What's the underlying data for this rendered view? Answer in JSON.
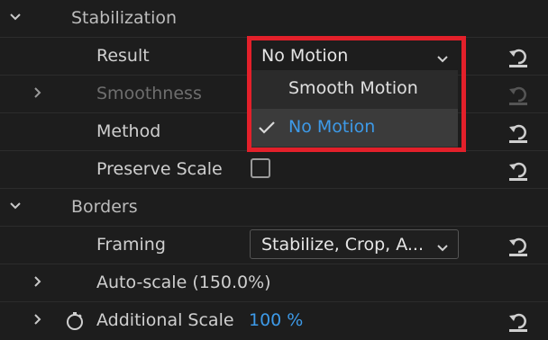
{
  "sections": {
    "stabilization": {
      "label": "Stabilization"
    },
    "borders": {
      "label": "Borders"
    }
  },
  "properties": {
    "result": {
      "label": "Result",
      "value": "No Motion"
    },
    "smoothness": {
      "label": "Smoothness"
    },
    "method": {
      "label": "Method"
    },
    "preserve_scale": {
      "label": "Preserve Scale",
      "checked": false
    },
    "framing": {
      "label": "Framing",
      "value": "Stabilize, Crop, A..."
    },
    "auto_scale": {
      "label": "Auto-scale (150.0%)"
    },
    "additional_scale": {
      "label": "Additional Scale",
      "value": "100 %"
    }
  },
  "menu": {
    "options": [
      "Smooth Motion",
      "No Motion"
    ],
    "selected": "No Motion"
  },
  "icons": {
    "expand": "chevron-down-icon",
    "collapse": "chevron-right-icon",
    "reset": "reset-icon",
    "stopwatch": "stopwatch-icon",
    "check": "checkmark-icon",
    "caret": "caret-down-icon"
  },
  "colors": {
    "background": "#1d1d1d",
    "text": "#cfcfcf",
    "disabled_text": "#6e6e6e",
    "accent_blue": "#3d9ae8",
    "highlight_red": "#e3202a"
  }
}
